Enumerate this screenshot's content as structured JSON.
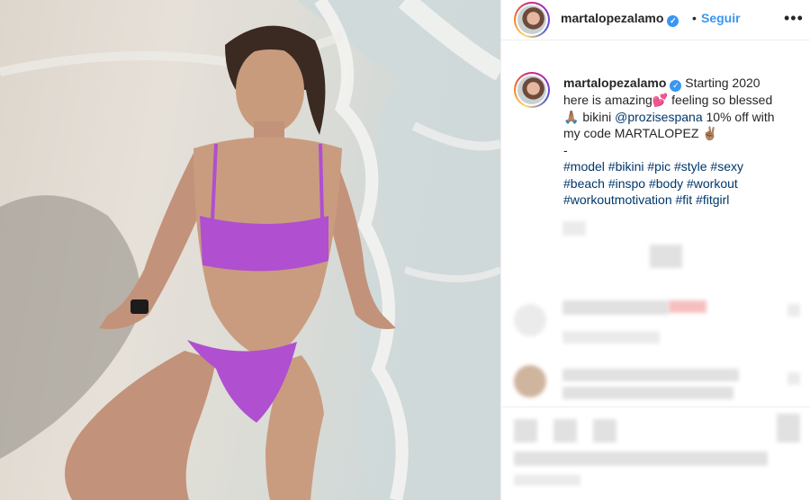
{
  "post": {
    "username": "martalopezalamo",
    "follow_label": "Seguir",
    "separator": "•",
    "more_label": "•••",
    "caption": {
      "username": "martalopezalamo",
      "line1": "Starting 2020",
      "line2": "here is amazing💕  feeling so blessed",
      "line3_prefix": "🙏🏽 bikini ",
      "mention": "@prozisespana",
      "line3_suffix": " 10% off with",
      "line4": "my code MARTALOPEZ ✌🏽",
      "dash": "-",
      "tags_line1": "#model #bikini #pic #style #sexy",
      "tags_line2": "#beach #inspo #body #workout",
      "tags_line3": "#workoutmotivation #fit #fitgirl"
    }
  },
  "icons": {
    "verified": "verified-badge-icon",
    "more": "more-options-icon"
  },
  "colors": {
    "link_blue": "#3897f0",
    "hashtag": "#00376b",
    "text": "#262626",
    "divider": "#efefef",
    "bikini": "#b04fd0"
  }
}
